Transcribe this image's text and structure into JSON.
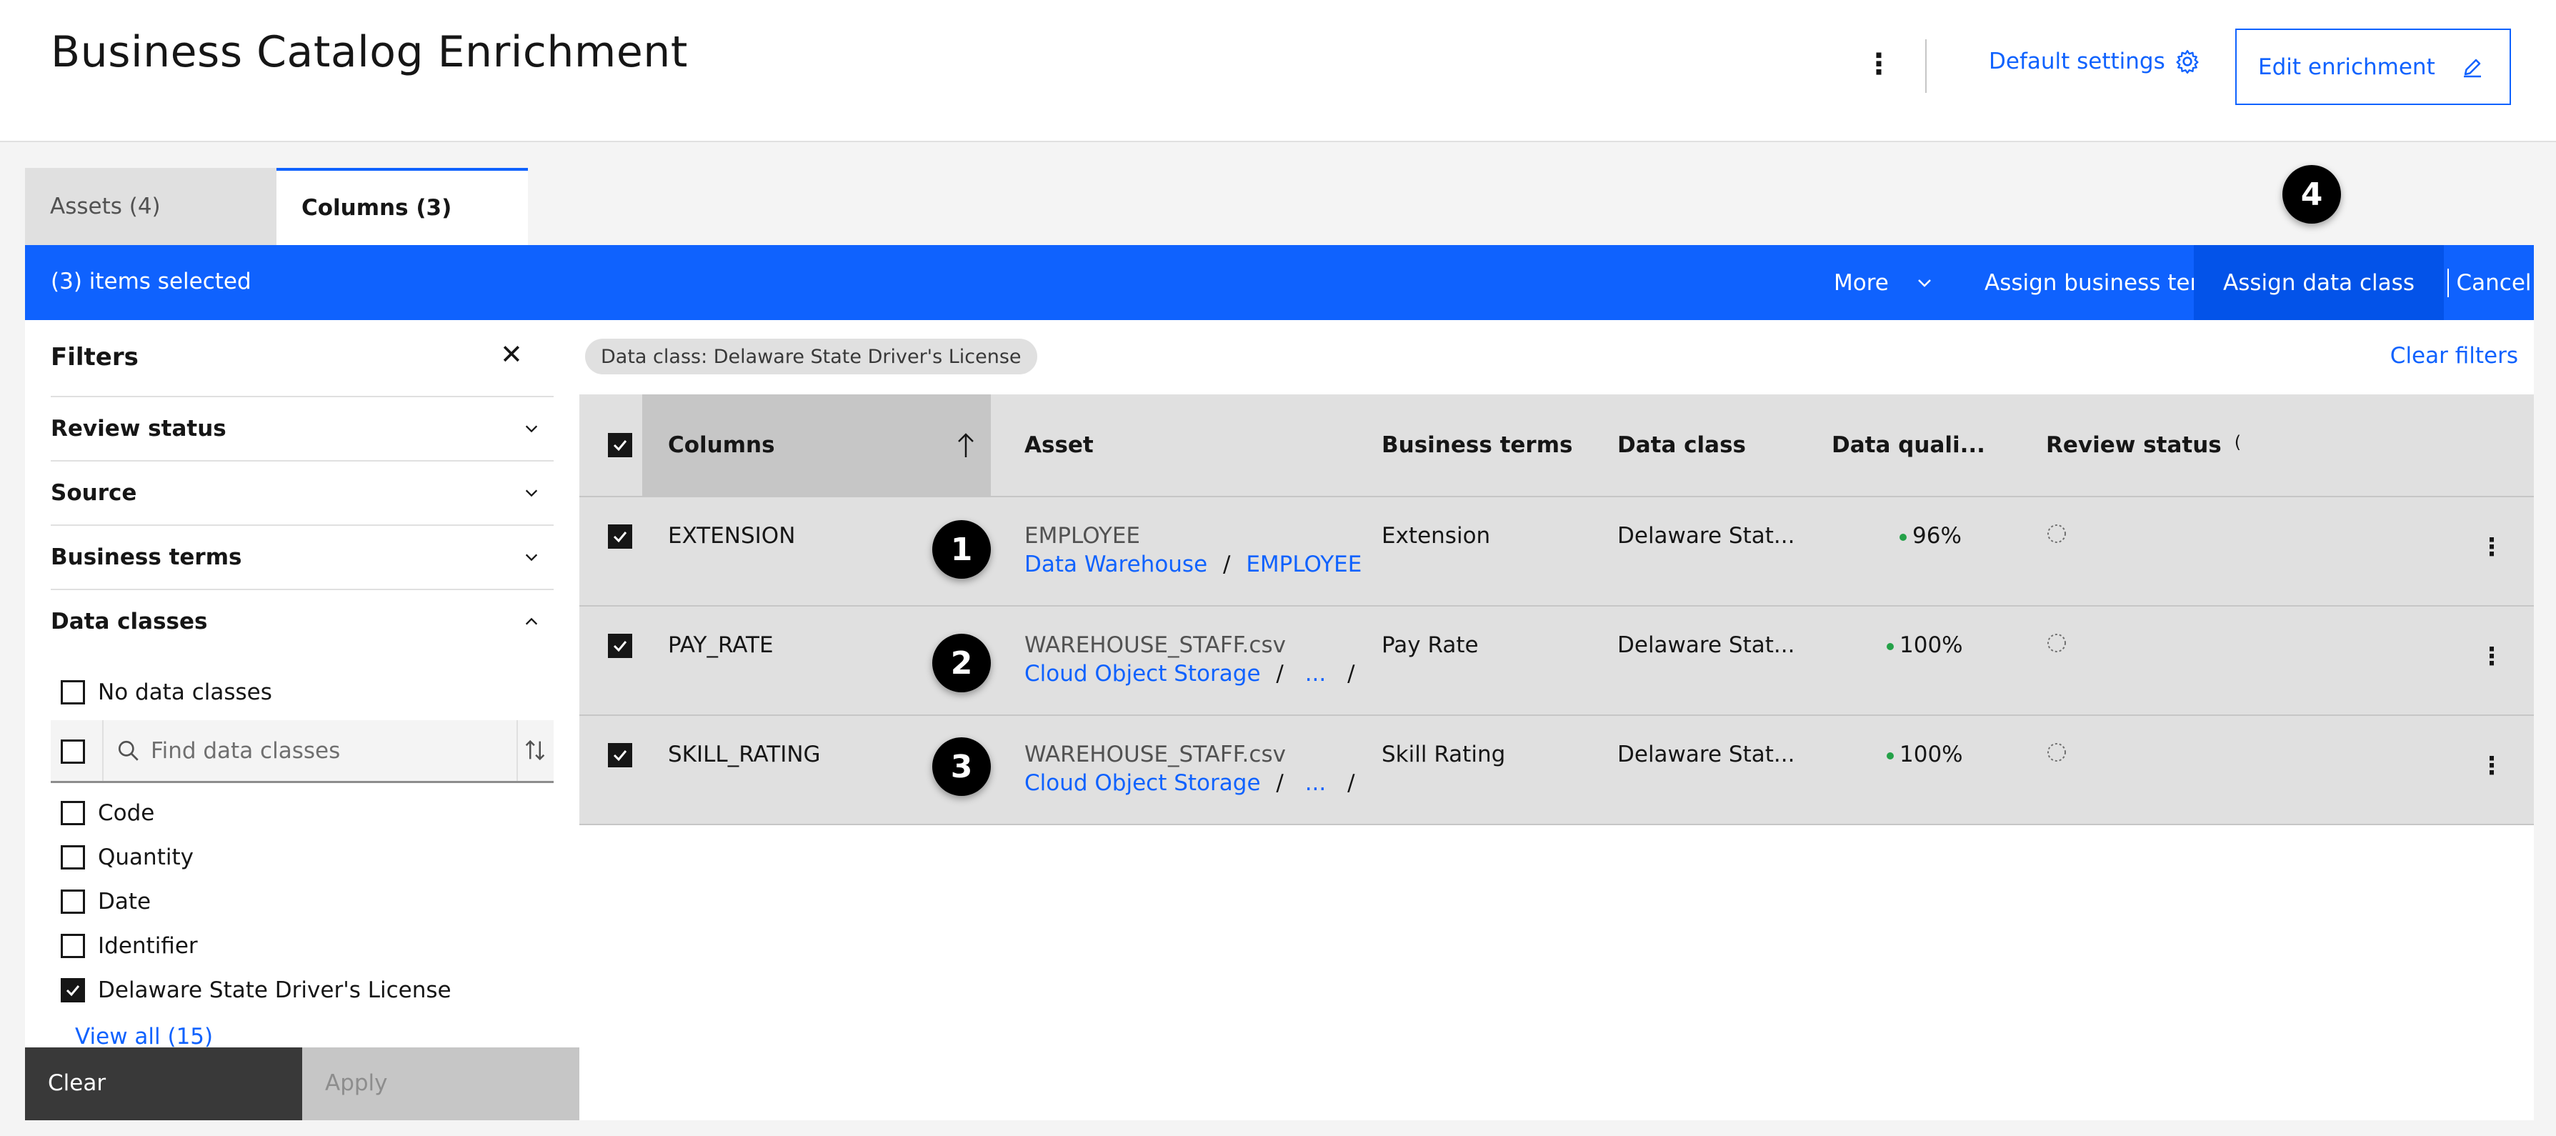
{
  "header": {
    "title": "Business Catalog Enrichment",
    "overflow_icon": "overflow-menu-vertical-icon",
    "default_settings_label": "Default settings",
    "default_settings_icon": "gear-icon",
    "edit_enrichment_label": "Edit enrichment",
    "edit_icon": "pencil-icon"
  },
  "tabs": [
    {
      "label": "Assets (4)",
      "selected": false
    },
    {
      "label": "Columns (3)",
      "selected": true
    }
  ],
  "callouts": [
    "1",
    "2",
    "3",
    "4"
  ],
  "bulk_actions": {
    "selected_text": "(3) items selected",
    "more_label": "More",
    "assign_term_label": "Assign business term",
    "assign_class_label": "Assign data class",
    "cancel_label": "Cancel"
  },
  "filters": {
    "title": "Filters",
    "close_icon": "close-icon",
    "facets": [
      {
        "label": "Review status",
        "expanded": false
      },
      {
        "label": "Source",
        "expanded": false
      },
      {
        "label": "Business terms",
        "expanded": false
      },
      {
        "label": "Data classes",
        "expanded": true
      }
    ],
    "no_data_classes_label": "No data classes",
    "search_placeholder": "Find data classes",
    "options": [
      {
        "label": "Code",
        "checked": false
      },
      {
        "label": "Quantity",
        "checked": false
      },
      {
        "label": "Date",
        "checked": false
      },
      {
        "label": "Identifier",
        "checked": false
      },
      {
        "label": "Delaware State Driver's License",
        "checked": true
      }
    ],
    "view_all_label": "View all (15)",
    "clear_label": "Clear",
    "apply_label": "Apply"
  },
  "main": {
    "active_filter_tag": "Data class: Delaware State Driver's License",
    "clear_filters_label": "Clear filters",
    "table": {
      "headers": {
        "columns": "Columns",
        "asset": "Asset",
        "business_terms": "Business terms",
        "data_class": "Data class",
        "data_quality": "Data quali...",
        "review_status": "Review status",
        "review_status_partial": "("
      },
      "rows": [
        {
          "column": "EXTENSION",
          "asset_name": "EMPLOYEE",
          "path1": "Data Warehouse",
          "sep1": "/",
          "path2": "EMPLOYEE",
          "sep2": "",
          "business_term": "Extension",
          "data_class": "Delaware Stat...",
          "data_quality": "96%"
        },
        {
          "column": "PAY_RATE",
          "asset_name": "WAREHOUSE_STAFF.csv",
          "path1": "Cloud Object Storage",
          "sep1": "/",
          "path2": "...",
          "sep2": "/",
          "business_term": "Pay Rate",
          "data_class": "Delaware Stat...",
          "data_quality": "100%"
        },
        {
          "column": "SKILL_RATING",
          "asset_name": "WAREHOUSE_STAFF.csv",
          "path1": "Cloud Object Storage",
          "sep1": "/",
          "path2": "...",
          "sep2": "/",
          "business_term": "Skill Rating",
          "data_class": "Delaware Stat...",
          "data_quality": "100%"
        }
      ]
    }
  },
  "colors": {
    "accent": "#0f62fe",
    "bulk_bar": "#0f62fe",
    "quality_dot": "#24a148"
  }
}
